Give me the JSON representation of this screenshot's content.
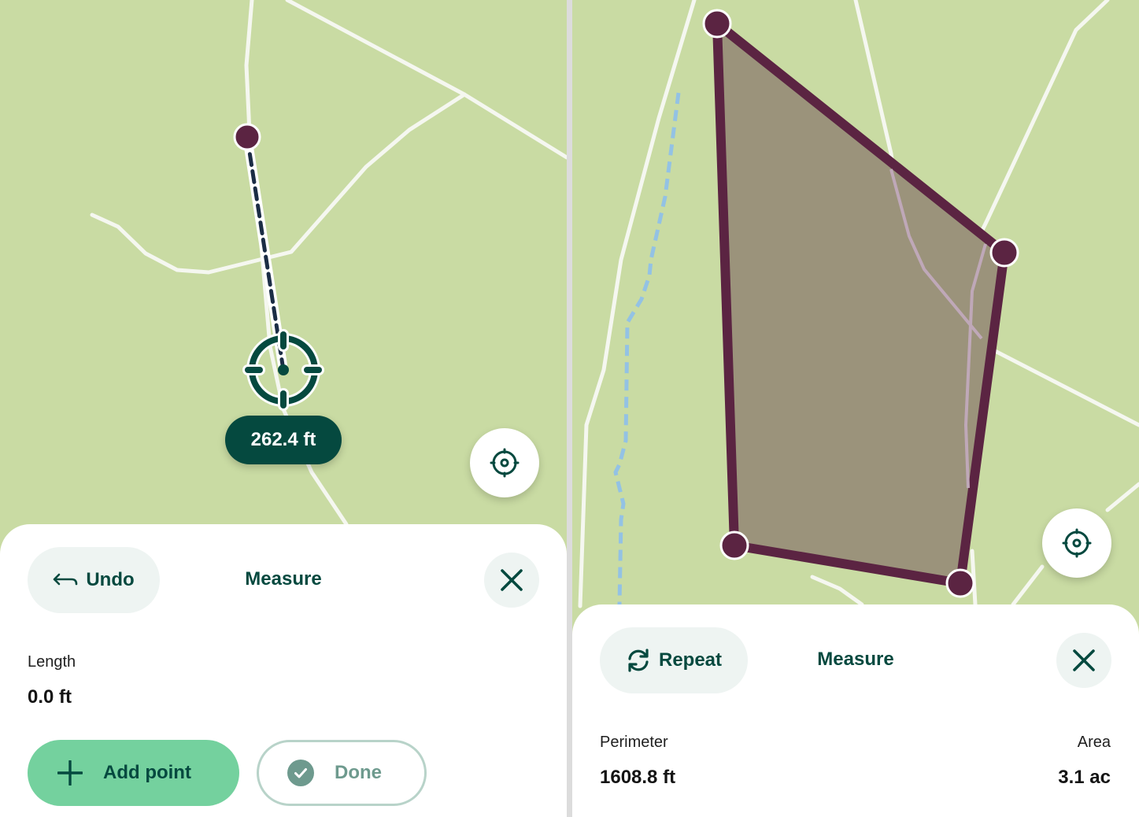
{
  "left_screen": {
    "map": {
      "distance_label": "262.4 ft",
      "colors": {
        "land": "#c9dba3",
        "road": "#f5f7f0",
        "vertex": "#5b2442",
        "measure_line": "#1b2d45",
        "crosshair": "#05493f"
      }
    },
    "locate_button": {
      "icon": "locate-crosshair-icon"
    },
    "sheet": {
      "undo_label": "Undo",
      "undo_icon": "undo-arrow-icon",
      "title": "Measure",
      "close_icon": "close-icon",
      "metric": {
        "label": "Length",
        "value": "0.0 ft"
      },
      "add_point_label": "Add point",
      "add_point_icon": "plus-icon",
      "done_label": "Done",
      "done_icon": "check-circle-icon"
    }
  },
  "right_screen": {
    "map": {
      "colors": {
        "land": "#c9dba3",
        "road": "#f5f7f0",
        "polygon_fill": "#9b937b",
        "polygon_stroke": "#5b2442",
        "path": "#bfa8b8",
        "stream": "#93c2e4"
      }
    },
    "locate_button": {
      "icon": "locate-crosshair-icon"
    },
    "sheet": {
      "repeat_label": "Repeat",
      "repeat_icon": "refresh-icon",
      "title": "Measure",
      "close_icon": "close-icon",
      "perimeter": {
        "label": "Perimeter",
        "value": "1608.8 ft"
      },
      "area": {
        "label": "Area",
        "value": "3.1 ac"
      }
    }
  },
  "theme": {
    "accent": "#05493f",
    "button_bg": "#eef4f2",
    "primary_button": "#74d19e",
    "disabled_border": "#b8d3c9"
  }
}
